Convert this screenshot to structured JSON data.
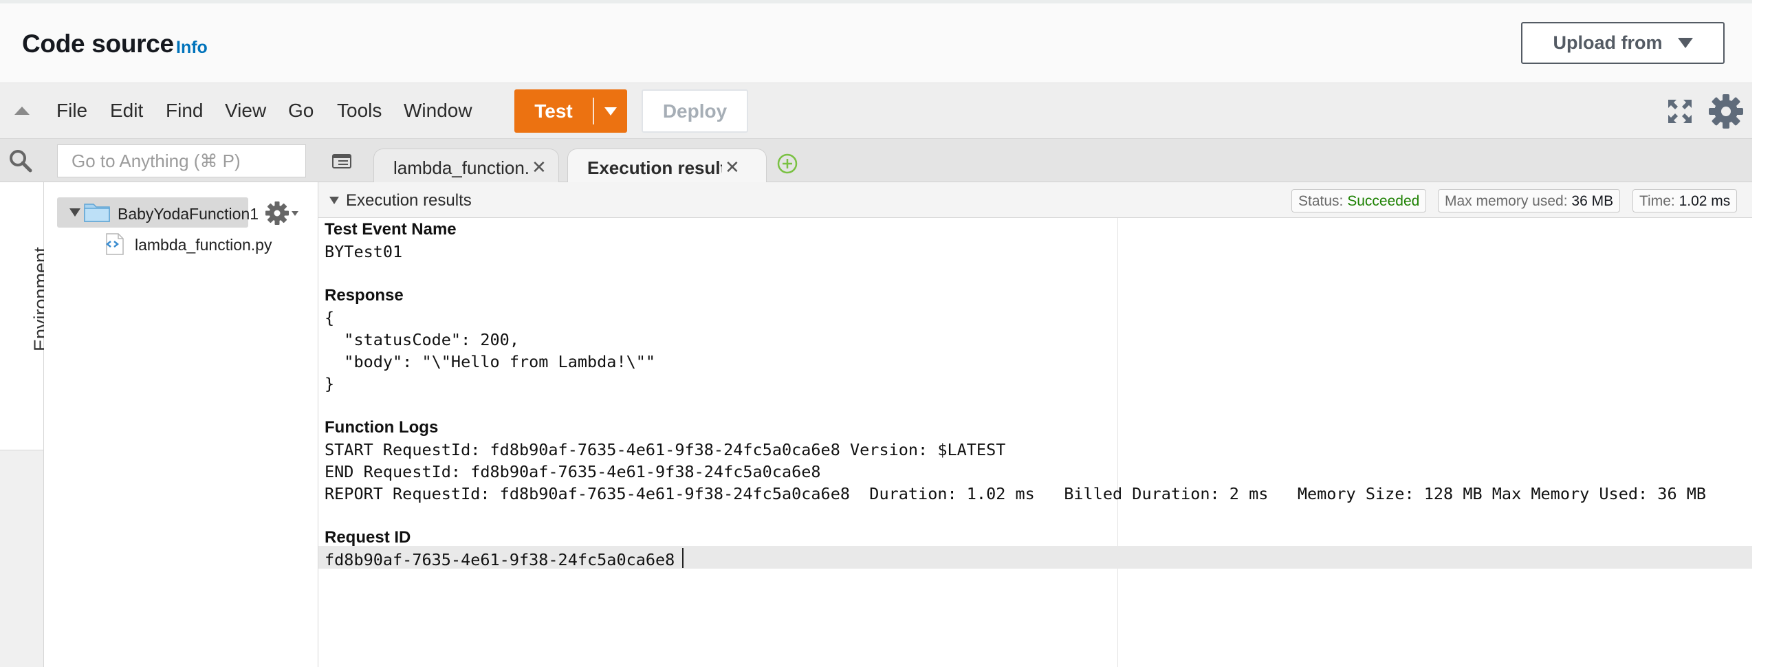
{
  "header": {
    "title": "Code source",
    "info_link": "Info",
    "upload_button": "Upload from"
  },
  "toolbar": {
    "menus": [
      "File",
      "Edit",
      "Find",
      "View",
      "Go",
      "Tools",
      "Window"
    ],
    "test_button": "Test",
    "deploy_button": "Deploy"
  },
  "sidebar": {
    "search_placeholder": "Go to Anything (⌘ P)",
    "environment_tab": "Environment",
    "folder": "BabyYodaFunction1",
    "file": "lambda_function.py"
  },
  "tabs": [
    {
      "label": "lambda_function.py",
      "active": false
    },
    {
      "label": "Execution results",
      "active": true
    }
  ],
  "results": {
    "panel_title": "Execution results",
    "status_label": "Status:",
    "status_value": "Succeeded",
    "memory_label": "Max memory used:",
    "memory_value": "36 MB",
    "time_label": "Time:",
    "time_value": "1.02 ms"
  },
  "output": {
    "test_event_heading": "Test Event Name",
    "test_event_value": "BYTest01",
    "response_heading": "Response",
    "response_lines": [
      "{",
      "  \"statusCode\": 200,",
      "  \"body\": \"\\\"Hello from Lambda!\\\"\"",
      "}"
    ],
    "logs_heading": "Function Logs",
    "log_lines": [
      "START RequestId: fd8b90af-7635-4e61-9f38-24fc5a0ca6e8 Version: $LATEST",
      "END RequestId: fd8b90af-7635-4e61-9f38-24fc5a0ca6e8",
      "REPORT RequestId: fd8b90af-7635-4e61-9f38-24fc5a0ca6e8  Duration: 1.02 ms   Billed Duration: 2 ms   Memory Size: 128 MB Max Memory Used: 36 MB"
    ],
    "request_id_heading": "Request ID",
    "request_id_value": "fd8b90af-7635-4e61-9f38-24fc5a0ca6e8"
  },
  "colors": {
    "accent_orange": "#ec7211",
    "link_blue": "#0073bb",
    "success_green": "#1d8102"
  }
}
